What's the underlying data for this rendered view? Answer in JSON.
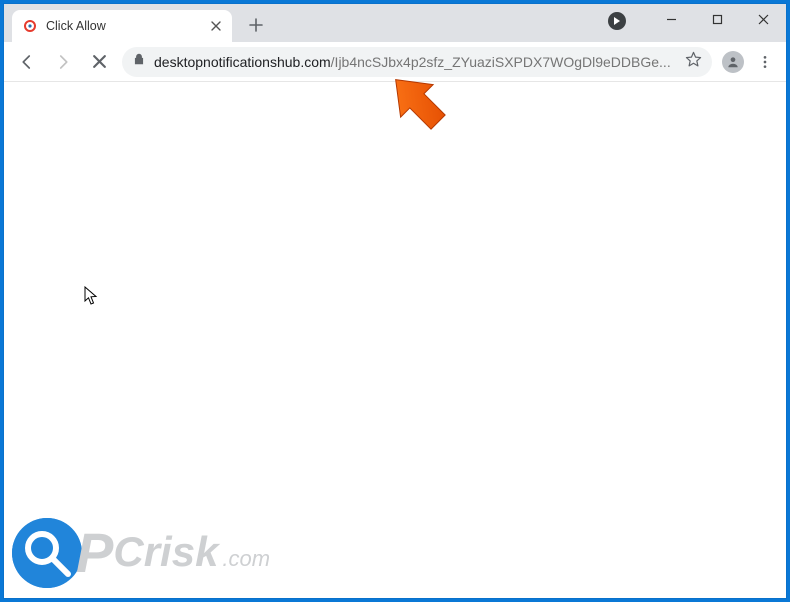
{
  "tab": {
    "title": "Click Allow"
  },
  "url": {
    "domain": "desktopnotificationshub.com",
    "path": "/Ijb4ncSJbx4p2sfz_ZYuaziSXPDX7WOgDl9eDDBGe..."
  },
  "icons": {
    "back": "back-icon",
    "forward": "forward-icon",
    "stop": "stop-icon",
    "lock": "lock-icon",
    "star": "star-icon",
    "avatar": "avatar-icon",
    "menu": "menu-icon",
    "minimize": "minimize-icon",
    "maximize": "maximize-icon",
    "close": "close-icon",
    "newtab": "plus-icon",
    "tabclose": "x-icon",
    "media": "media-icon"
  },
  "watermark": {
    "brand_p": "P",
    "brand_rest": "Crisk",
    "suffix": ".com"
  }
}
